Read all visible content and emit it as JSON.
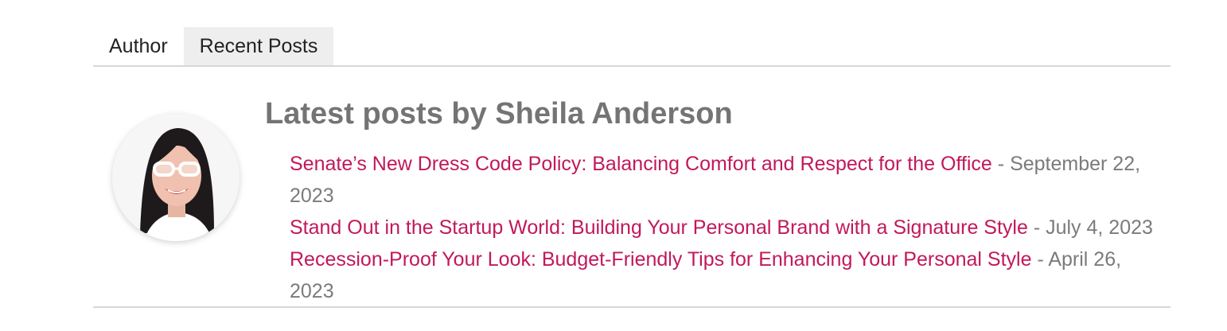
{
  "tabs": [
    {
      "label": "Author"
    },
    {
      "label": "Recent Posts"
    }
  ],
  "author": {
    "heading": "Latest posts by Sheila Anderson",
    "avatar_icon": "author-photo"
  },
  "posts": [
    {
      "title": "Senate’s New Dress Code Policy: Balancing Comfort and Respect for the Office",
      "date": "September 22, 2023"
    },
    {
      "title": "Stand Out in the Startup World: Building Your Personal Brand with a Signature Style",
      "date": "July 4, 2023"
    },
    {
      "title": "Recession-Proof Your Look: Budget-Friendly Tips for Enhancing Your Personal Style",
      "date": "April 26, 2023"
    }
  ],
  "colors": {
    "link": "#c2185b",
    "heading": "#747474",
    "meta": "#7b7b7b",
    "active_tab_bg": "#eeeeee",
    "divider": "#d7d7d7"
  }
}
